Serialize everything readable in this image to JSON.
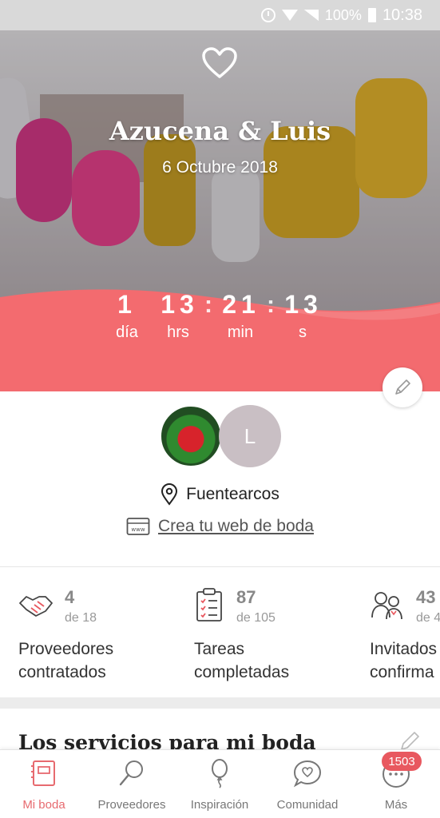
{
  "status_bar": {
    "battery": "100%",
    "time": "10:38"
  },
  "hero": {
    "couple": "Azucena & Luis",
    "date": "6 Octubre 2018",
    "countdown": {
      "days": "1",
      "days_label": "día",
      "hours": "13",
      "hours_label": "hrs",
      "minutes": "21",
      "minutes_label": "min",
      "seconds": "13",
      "seconds_label": "s"
    }
  },
  "profile": {
    "avatar_initial": "L",
    "location": "Fuentearcos",
    "web_link": "Crea tu web de boda"
  },
  "stats": [
    {
      "value": "4",
      "of": "de 18",
      "label1": "Proveedores",
      "label2": "contratados"
    },
    {
      "value": "87",
      "of": "de 105",
      "label1": "Tareas",
      "label2": "completadas"
    },
    {
      "value": "43",
      "of": "de 4",
      "label1": "Invitados",
      "label2": "confirma"
    }
  ],
  "section_title": "Los servicios para mi boda",
  "bottom_nav": [
    {
      "label": "Mi boda",
      "active": true
    },
    {
      "label": "Proveedores"
    },
    {
      "label": "Inspiración"
    },
    {
      "label": "Comunidad"
    },
    {
      "label": "Más",
      "badge": "1503"
    }
  ],
  "colors": {
    "accent": "#f36b6f",
    "nav_active": "#e76a6f"
  }
}
